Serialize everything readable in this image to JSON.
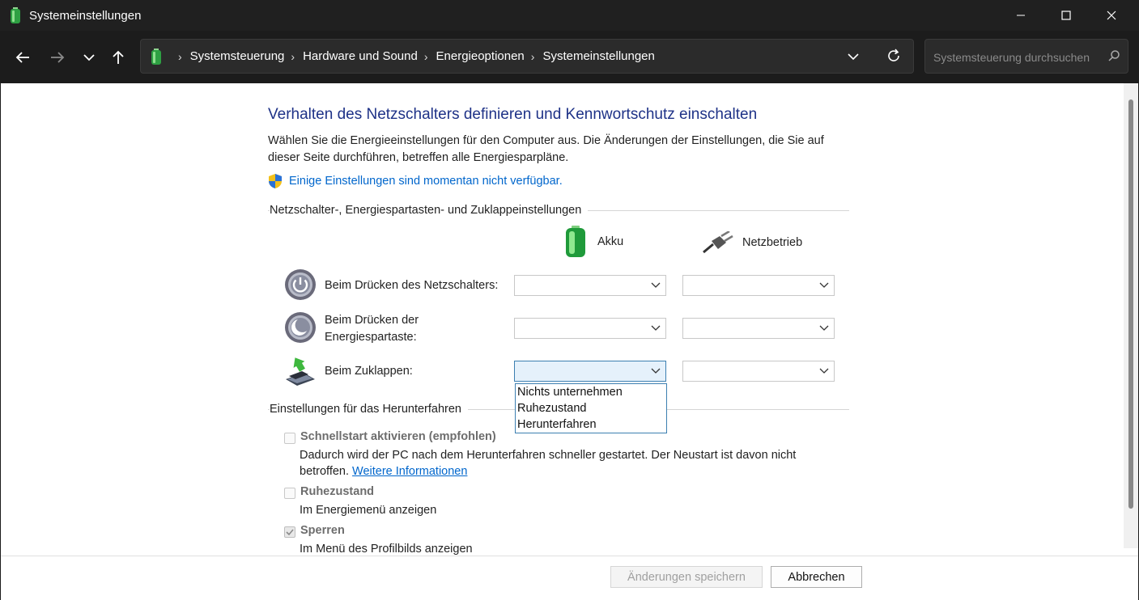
{
  "window": {
    "title": "Systemeinstellungen"
  },
  "breadcrumb": [
    "Systemsteuerung",
    "Hardware und Sound",
    "Energieoptionen",
    "Systemeinstellungen"
  ],
  "search": {
    "placeholder": "Systemsteuerung durchsuchen"
  },
  "page": {
    "title": "Verhalten des Netzschalters definieren und Kennwortschutz einschalten",
    "description": "Wählen Sie die Energieeinstellungen für den Computer aus. Die Änderungen der Einstellungen, die Sie auf dieser Seite durchführen, betreffen alle Energiesparpläne.",
    "unavailable_link": "Einige Einstellungen sind momentan nicht verfügbar."
  },
  "power_group": {
    "title": "Netzschalter-, Energiespartasten- und Zuklappeinstellungen",
    "col_battery": "Akku",
    "col_plugged": "Netzbetrieb",
    "rows": [
      {
        "label": "Beim Drücken des Netzschalters:"
      },
      {
        "label": "Beim Drücken der Energiespartaste:"
      },
      {
        "label": "Beim Zuklappen:"
      }
    ],
    "dropdown_options": [
      "Nichts unternehmen",
      "Ruhezustand",
      "Herunterfahren"
    ]
  },
  "shutdown_group": {
    "title": "Einstellungen für das Herunterfahren",
    "items": [
      {
        "title": "Schnellstart aktivieren (empfohlen)",
        "desc": "Dadurch wird der PC nach dem Herunterfahren schneller gestartet. Der Neustart ist davon nicht betroffen.",
        "link": "Weitere Informationen",
        "checked": false
      },
      {
        "title": "Ruhezustand",
        "desc": "Im Energiemenü anzeigen",
        "checked": false
      },
      {
        "title": "Sperren",
        "desc": "Im Menü des Profilbilds anzeigen",
        "checked": true
      }
    ]
  },
  "footer": {
    "save_label": "Änderungen speichern",
    "cancel_label": "Abbrechen"
  },
  "colors": {
    "title_blue": "#1e3287",
    "link_blue": "#0066cc",
    "chrome_dark": "#202020",
    "select_active_bg": "#e5f1fb"
  }
}
